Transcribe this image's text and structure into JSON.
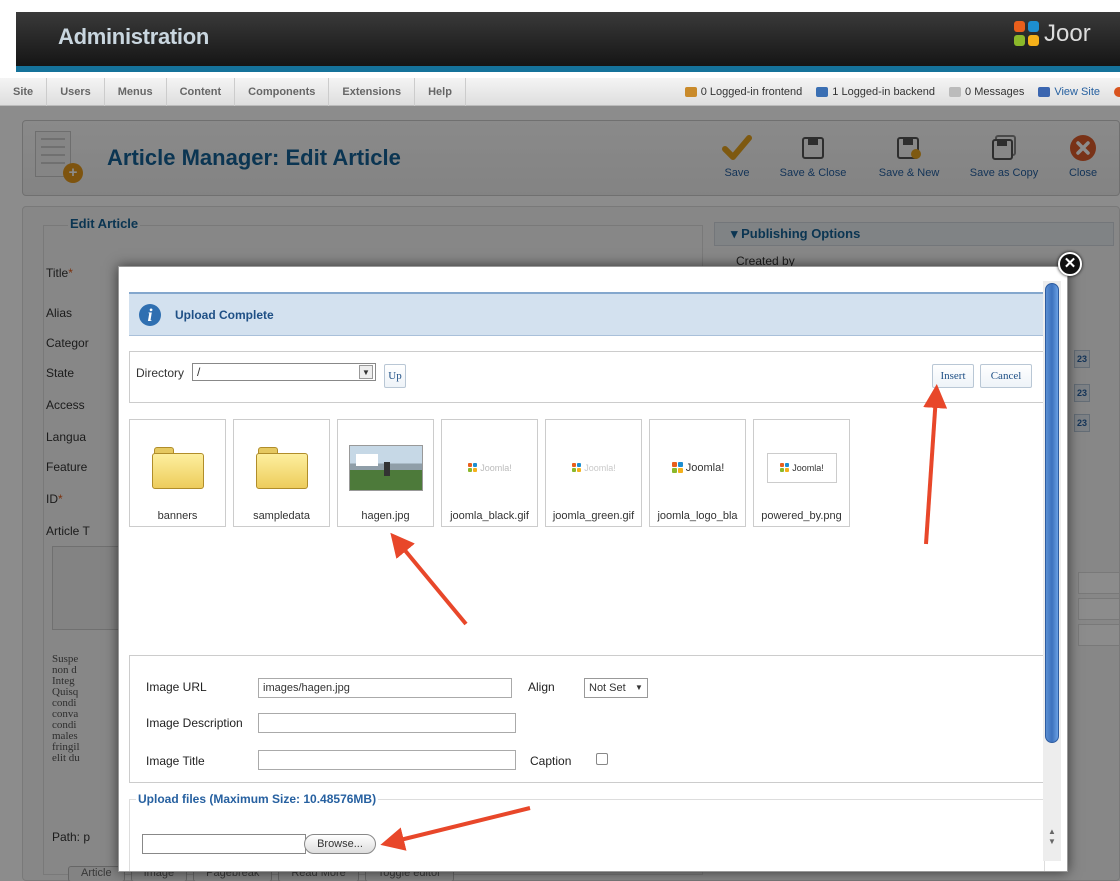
{
  "header": {
    "title": "Administration",
    "logo_text": "Joor"
  },
  "menu": {
    "items": [
      "Site",
      "Users",
      "Menus",
      "Content",
      "Components",
      "Extensions",
      "Help"
    ]
  },
  "status": {
    "frontend": "0 Logged-in frontend",
    "backend": "1 Logged-in backend",
    "messages": "0 Messages",
    "view_site": "View Site"
  },
  "toolbar": {
    "title": "Article Manager: Edit Article",
    "buttons": [
      "Save",
      "Save & Close",
      "Save & New",
      "Save as Copy",
      "Close"
    ]
  },
  "form": {
    "legend": "Edit Article",
    "fields": [
      "Title",
      "Alias",
      "Categor",
      "State",
      "Access",
      "Langua",
      "Feature",
      "ID",
      "Article T"
    ],
    "required_marker": "*",
    "editor_text": [
      "Suspe",
      "non d",
      "Integ",
      "Quisq",
      "condi",
      "conva",
      "condi",
      "males",
      "fringil",
      "elit du"
    ],
    "path_label": "Path: p",
    "bottom_buttons": [
      "Article",
      "Image",
      "Pagebreak",
      "Read More",
      "Toggle editor"
    ]
  },
  "publishing": {
    "title": "Publishing Options",
    "created_by": "Created by"
  },
  "modal": {
    "message": "Upload Complete",
    "directory_label": "Directory",
    "directory_value": "/",
    "up": "Up",
    "insert": "Insert",
    "cancel": "Cancel",
    "files": [
      {
        "name": "banners",
        "kind": "folder"
      },
      {
        "name": "sampledata",
        "kind": "folder"
      },
      {
        "name": "hagen.jpg",
        "kind": "photo"
      },
      {
        "name": "joomla_black.gif",
        "kind": "logo"
      },
      {
        "name": "joomla_green.gif",
        "kind": "logo"
      },
      {
        "name": "joomla_logo_bla",
        "kind": "logo"
      },
      {
        "name": "powered_by.png",
        "kind": "logo"
      }
    ],
    "image_url_label": "Image URL",
    "image_url_value": "images/hagen.jpg",
    "align_label": "Align",
    "align_value": "Not Set",
    "desc_label": "Image Description",
    "title_label": "Image Title",
    "caption_label": "Caption",
    "upload_legend": "Upload files (Maximum Size: 10.48576MB)",
    "browse": "Browse..."
  },
  "icons": {
    "close": "close-icon",
    "info": "info-icon"
  },
  "colors": {
    "accent": "#146295",
    "arrow": "#e8472a",
    "header_bar": "#15729a"
  }
}
